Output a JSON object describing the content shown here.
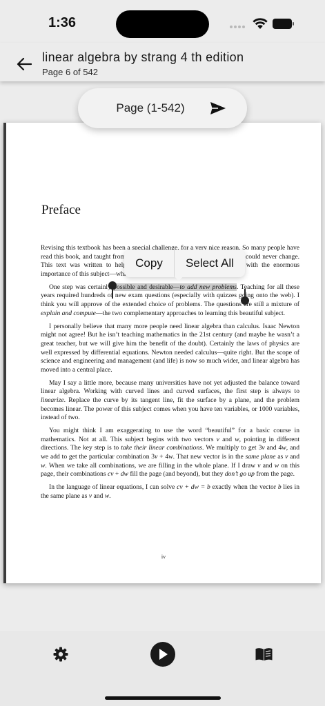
{
  "status_bar": {
    "time": "1:36"
  },
  "app_bar": {
    "back_icon": "arrow-left-icon",
    "title": "linear algebra by strang 4 th edition",
    "subtitle": "Page 6 of 542"
  },
  "page_jump": {
    "placeholder": "Page (1-542)",
    "send_icon": "send-icon"
  },
  "context_menu": {
    "copy": "Copy",
    "select_all": "Select All"
  },
  "document": {
    "heading": "Preface",
    "p1": "Revising this textbook has been a special challenge, for a very nice reason. So many people have read this book, and taught from it, and even loved it. The spirit of the book could never change. This text was written to help our teaching of linear algebra keep up with the enormous importance of this subject—which just continues to grow.",
    "p2_before": "One step was certainly ",
    "p2_highlight_a": "possible and desirable—",
    "p2_highlight_b": "to add new problems",
    "p2_after": ". Teaching for all these years required hundreds of new exam questions (especially with quizzes going onto the web). I think you will approve of the extended choice of problems. The questions are still a mixture of ",
    "p2_italic": "explain and compute",
    "p2_end": "—the two complementary approaches to learning this beautiful subject.",
    "p3": "I personally believe that many more people need linear algebra than calculus. Isaac Newton might not agree! But he isn’t teaching mathematics in the 21st century (and maybe he wasn’t a great teacher, but we will give him the benefit of the doubt). Certainly the laws of physics are well expressed by differential equations. Newton needed calculus—quite right. But the scope of science and engineering and management (and life) is now so much wider, and linear algebra has moved into a central place.",
    "p4_before": "May I say a little more, because many universities have not yet adjusted the balance toward linear algebra. Working with curved lines and curved surfaces, the first step is always to ",
    "p4_italic": "linearize",
    "p4_after": ". Replace the curve by its tangent line, fit the surface by a plane, and the problem becomes linear. The power of this subject comes when you have ten variables, or 1000 variables, instead of two.",
    "p5_a": "You might think I am exaggerating to use the word “beautiful” for a basic course in mathematics. Not at all. This subject begins with two vectors ",
    "p5_v1": "v",
    "p5_b": " and ",
    "p5_w1": "w",
    "p5_c": ", pointing in different directions. The key step is to ",
    "p5_italic1": "take their linear combinations",
    "p5_d": ". We multiply to get 3",
    "p5_v2": "v",
    "p5_e": " and 4",
    "p5_w2": "w",
    "p5_f": ", and we add to get the particular combination 3",
    "p5_v3": "v",
    "p5_g": " + 4",
    "p5_w3": "w",
    "p5_h": ". That new vector is in the ",
    "p5_italic2": "same plane",
    "p5_i": " as ",
    "p5_v4": "v",
    "p5_j": " and ",
    "p5_w4": "w",
    "p5_k": ". When we take all combinations, we are filling in the whole plane. If I draw ",
    "p5_v5": "v",
    "p5_l": " and ",
    "p5_w5": "w",
    "p5_m": " on this page, their combinations ",
    "p5_cv": "cv",
    "p5_n": " + ",
    "p5_dw": "dw",
    "p5_o": " fill the page (and beyond), but they ",
    "p5_italic3": "don’t go up",
    "p5_p": " from the page.",
    "p6_a": "In the language of linear equations, I can solve ",
    "p6_eq": "cv + dw = b",
    "p6_b": " exactly when the vector ",
    "p6_bvar": "b",
    "p6_c": " lies in the same plane as ",
    "p6_v": "v",
    "p6_d": " and ",
    "p6_w": "w",
    "p6_e": ".",
    "page_number": "iv"
  },
  "bottom_bar": {
    "settings_icon": "gear-icon",
    "play_icon": "play-icon",
    "book_icon": "open-book-icon"
  }
}
